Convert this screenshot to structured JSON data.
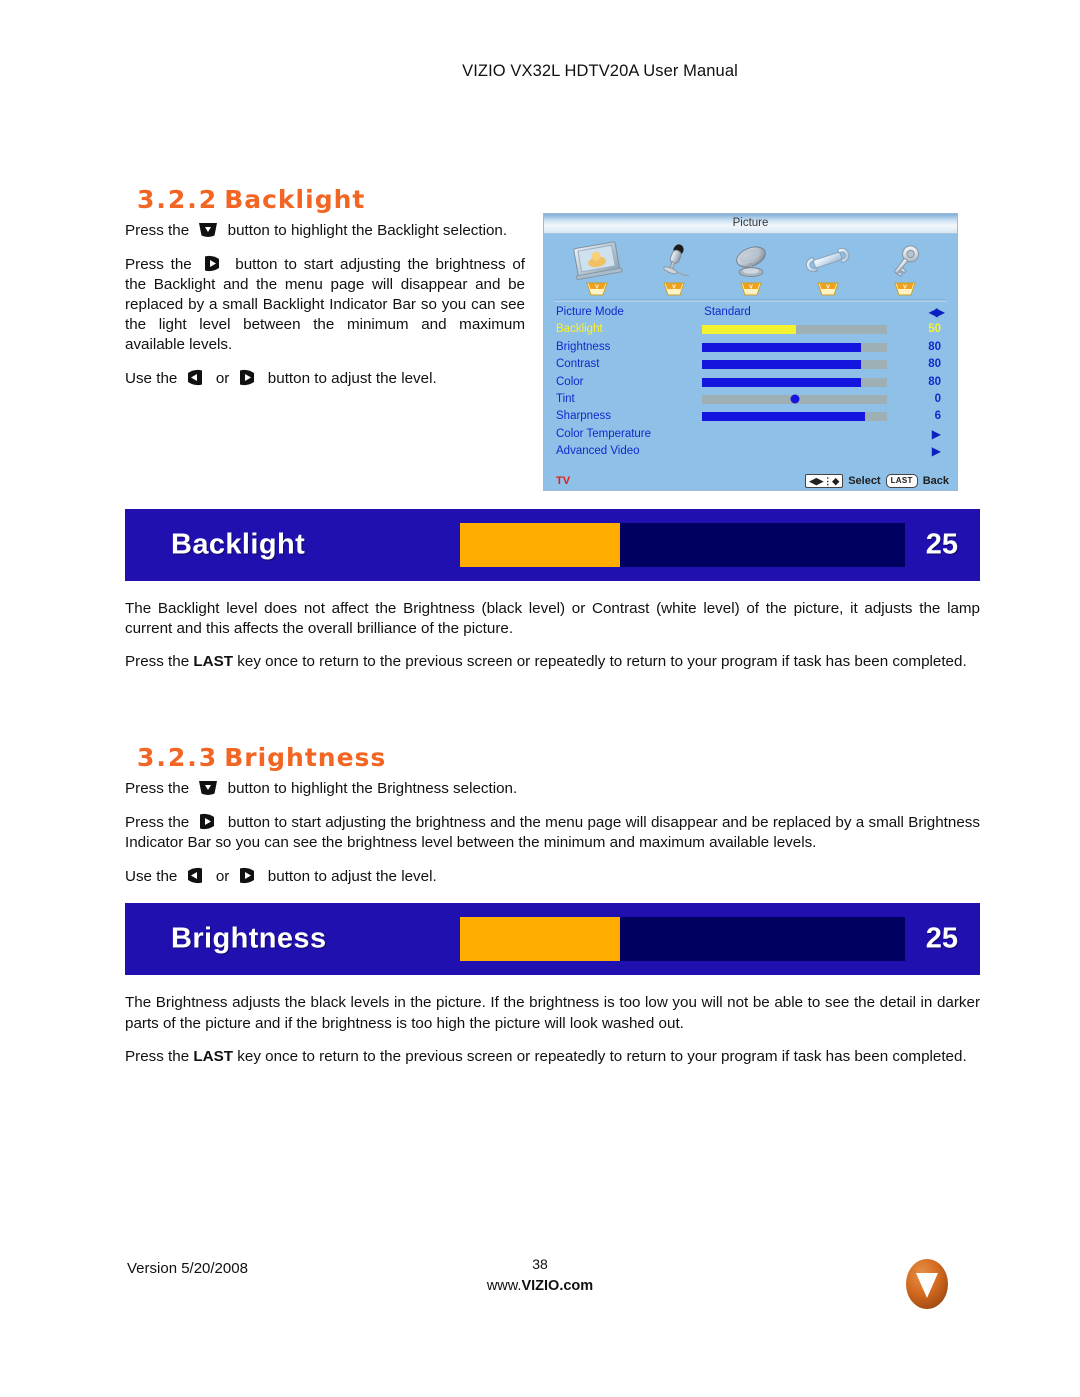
{
  "header": {
    "title": "VIZIO VX32L HDTV20A User Manual"
  },
  "sections": [
    {
      "number": "3.2.2",
      "name": "Backlight",
      "paragraphs": [
        {
          "pre": "Press the",
          "key": "down-arrow-key",
          "post": "button to highlight the Backlight selection."
        },
        {
          "pre": "Press the",
          "key": "right-arrow-key",
          "post": "button to start adjusting the brightness of the Backlight and the menu page will disappear and be replaced by a small Backlight Indicator Bar so you can see the light level between the minimum and maximum available levels."
        },
        {
          "pre": "Use the",
          "key": "left-arrow-key",
          "mid": "or",
          "key2": "right-arrow-key",
          "post": "button to adjust the level."
        }
      ],
      "indicator": {
        "label": "Backlight",
        "value": "25",
        "fill_percent": 36
      },
      "after": [
        "The Backlight level does not affect the Brightness (black level) or Contrast (white level) of the picture, it adjusts the lamp current and this affects the overall brilliance of the picture.",
        {
          "pre": "Press the",
          "strong": "LAST",
          "post": "key once to return to the previous screen or repeatedly to return to your program if task has been completed."
        }
      ]
    },
    {
      "number": "3.2.3",
      "name": "Brightness",
      "paragraphs": [
        {
          "pre": "Press the",
          "key": "down-arrow-key",
          "post": "button to highlight the Brightness selection."
        },
        {
          "pre": "Press the",
          "key": "right-arrow-key",
          "post": "button to start adjusting the brightness and the menu page will disappear and be replaced by a small Brightness Indicator Bar so you can see the brightness level between the minimum and maximum available levels."
        },
        {
          "pre": "Use the",
          "key": "left-arrow-key",
          "mid": "or",
          "key2": "right-arrow-key",
          "post": "button to adjust the level."
        }
      ],
      "indicator": {
        "label": "Brightness",
        "value": "25",
        "fill_percent": 36
      },
      "after": [
        "The Brightness adjusts the black levels in the picture.  If the brightness is too low you will not be able to see the detail in darker parts of the picture and if the brightness is too high the picture will look washed out.",
        {
          "pre": "Press the",
          "strong": "LAST",
          "post": "key once to return to the previous screen or repeatedly to return to your program if task has been completed."
        }
      ]
    }
  ],
  "osd": {
    "title": "Picture",
    "icons": [
      {
        "name": "picture-screen-icon",
        "badge": "V"
      },
      {
        "name": "microphone-audio-icon",
        "badge": "V"
      },
      {
        "name": "satellite-dish-tuner-icon",
        "badge": "V"
      },
      {
        "name": "wrench-setup-icon",
        "badge": "V"
      },
      {
        "name": "key-parental-icon",
        "badge": "V"
      }
    ],
    "rows": [
      {
        "label": "Picture Mode",
        "value_text": "Standard",
        "control": "lr-arrows",
        "highlight": false
      },
      {
        "label": "Backlight",
        "number": "50",
        "control": "bar",
        "fill_percent": 51,
        "highlight": true
      },
      {
        "label": "Brightness",
        "number": "80",
        "control": "bar",
        "fill_percent": 86,
        "highlight": false
      },
      {
        "label": "Contrast",
        "number": "80",
        "control": "bar",
        "fill_percent": 86,
        "highlight": false
      },
      {
        "label": "Color",
        "number": "80",
        "control": "bar",
        "fill_percent": 86,
        "highlight": false
      },
      {
        "label": "Tint",
        "number": "0",
        "control": "dot",
        "fill_percent": 50,
        "highlight": false
      },
      {
        "label": "Sharpness",
        "number": "6",
        "control": "bar",
        "fill_percent": 88,
        "highlight": false
      },
      {
        "label": "Color Temperature",
        "control": "caret",
        "highlight": false
      },
      {
        "label": "Advanced Video",
        "control": "caret",
        "highlight": false
      }
    ],
    "footer": {
      "source": "TV",
      "select_label": "Select",
      "last_key": "LAST",
      "back_label": "Back"
    }
  },
  "footer": {
    "version": "Version 5/20/2008",
    "page_number": "38",
    "website_prefix": "www.",
    "website_brand": "VIZIO",
    "website_suffix": ".com",
    "logo_letter": "V",
    "logo_color": "#D2691E"
  }
}
